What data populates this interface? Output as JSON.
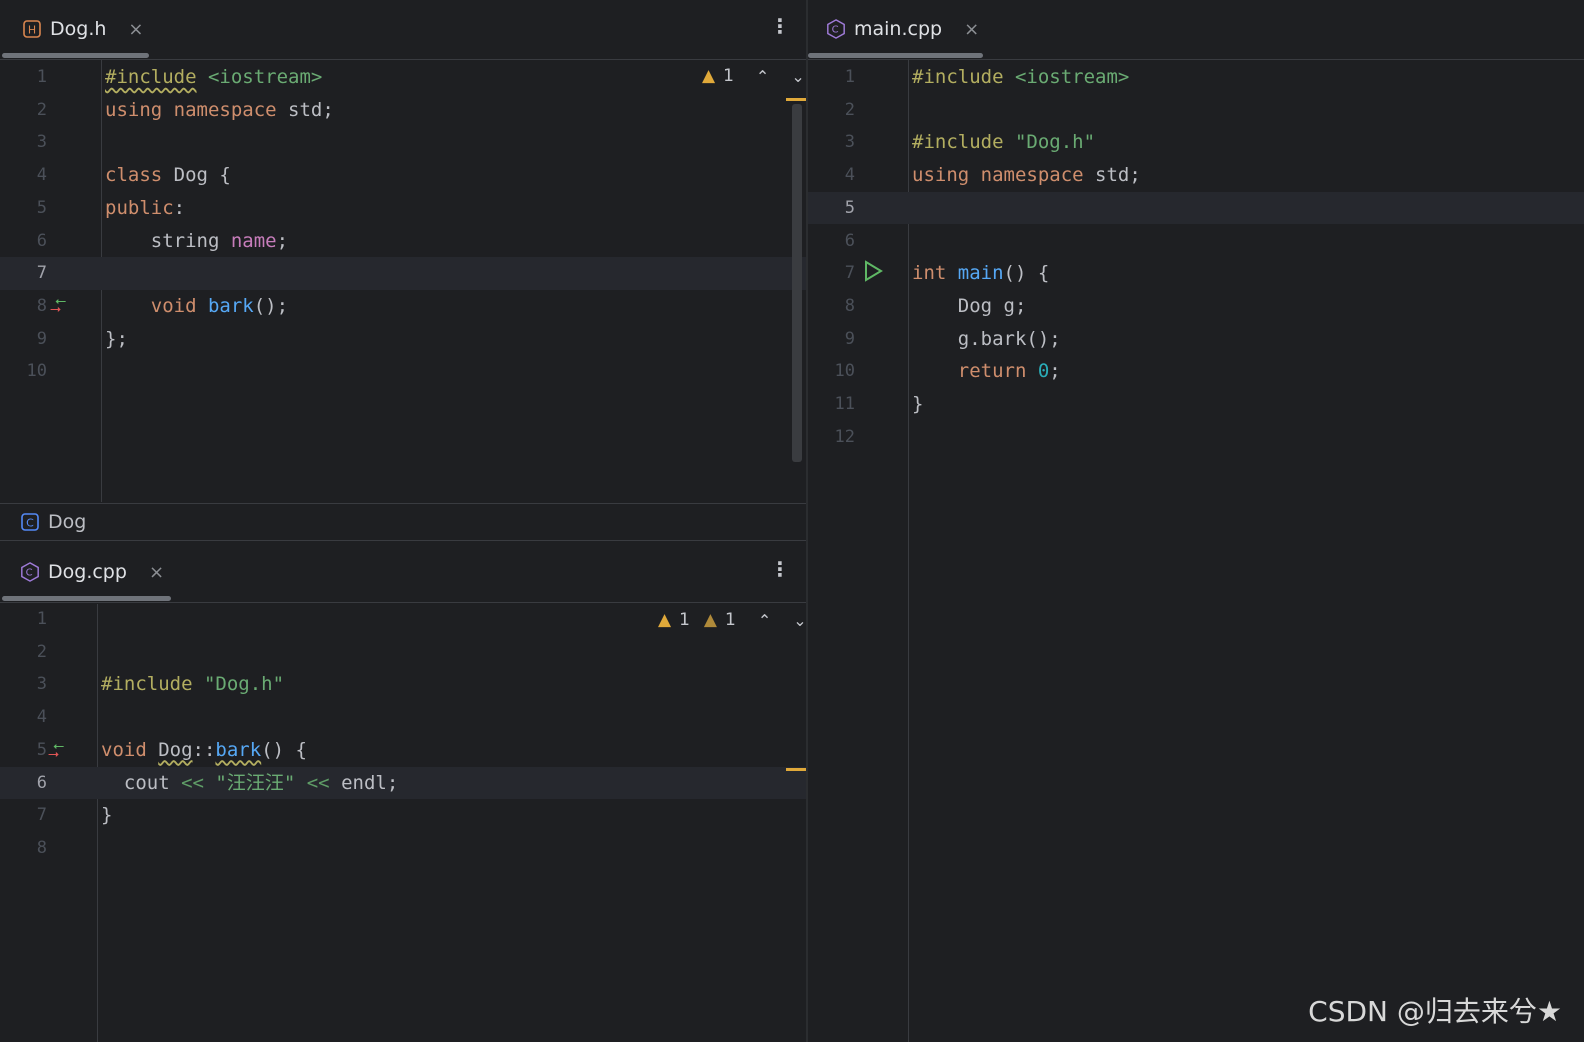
{
  "colors": {
    "background": "#1e1f22",
    "keyword": "#cf8e6d",
    "preprocessor": "#b3ae60",
    "string": "#6aab73",
    "function": "#56a8f5",
    "field": "#c77dbb",
    "number": "#2aacb8",
    "warning": "#e0a93a"
  },
  "dog_h": {
    "tab_label": "Dog.h",
    "file_icon_letter": "H",
    "close_glyph": "×",
    "menu_glyph": "⋮",
    "inspections": {
      "warnings": "1"
    },
    "breadcrumb": {
      "icon_letter": "C",
      "label": "Dog"
    },
    "lines": [
      {
        "n": "1",
        "parts": [
          [
            "pp wavy",
            "#include"
          ],
          [
            "",
            ""
          ],
          [
            "inc",
            " <iostream>"
          ]
        ]
      },
      {
        "n": "2",
        "parts": [
          [
            "kw",
            "using namespace "
          ],
          [
            "typ",
            "std;"
          ]
        ]
      },
      {
        "n": "3",
        "parts": []
      },
      {
        "n": "4",
        "parts": [
          [
            "kw",
            "class "
          ],
          [
            "typ",
            "Dog {"
          ]
        ]
      },
      {
        "n": "5",
        "parts": [
          [
            "kw",
            "public"
          ],
          [
            "typ",
            ":"
          ]
        ]
      },
      {
        "n": "6",
        "parts": [
          [
            "typ",
            "    string "
          ],
          [
            "fld",
            "name"
          ],
          [
            "typ",
            ";"
          ]
        ]
      },
      {
        "n": "7",
        "parts": []
      },
      {
        "n": "8",
        "parts": [
          [
            "kw",
            "    void "
          ],
          [
            "fn",
            "bark"
          ],
          [
            "typ",
            "();"
          ]
        ]
      },
      {
        "n": "9",
        "parts": [
          [
            "typ",
            "};"
          ]
        ]
      },
      {
        "n": "10",
        "parts": []
      }
    ]
  },
  "dog_cpp": {
    "tab_label": "Dog.cpp",
    "file_icon_letter": "C",
    "close_glyph": "×",
    "menu_glyph": "⋮",
    "inspections": {
      "warnings": "1",
      "weak_warnings": "1"
    },
    "lines": [
      {
        "n": "1",
        "parts": []
      },
      {
        "n": "2",
        "parts": []
      },
      {
        "n": "3",
        "parts": [
          [
            "pp",
            "#include "
          ],
          [
            "inc",
            "\"Dog.h\""
          ]
        ]
      },
      {
        "n": "4",
        "parts": []
      },
      {
        "n": "5",
        "parts": [
          [
            "kw",
            "void "
          ],
          [
            "typ wavy",
            "Dog"
          ],
          [
            "typ",
            "::"
          ],
          [
            "fn wavy",
            "bark"
          ],
          [
            "typ",
            "() {"
          ]
        ]
      },
      {
        "n": "6",
        "parts": [
          [
            "typ",
            "  cout "
          ],
          [
            "op",
            "<<"
          ],
          [
            "inc",
            " \"汪汪汪\" "
          ],
          [
            "op",
            "<<"
          ],
          [
            "typ",
            " endl;"
          ]
        ]
      },
      {
        "n": "7",
        "parts": [
          [
            "typ",
            "}"
          ]
        ]
      },
      {
        "n": "8",
        "parts": []
      }
    ]
  },
  "main_cpp": {
    "tab_label": "main.cpp",
    "file_icon_letter": "C",
    "close_glyph": "×",
    "lines": [
      {
        "n": "1",
        "parts": [
          [
            "pp",
            "#include "
          ],
          [
            "inc",
            "<iostream>"
          ]
        ]
      },
      {
        "n": "2",
        "parts": []
      },
      {
        "n": "3",
        "parts": [
          [
            "pp",
            "#include "
          ],
          [
            "inc",
            "\"Dog.h\""
          ]
        ]
      },
      {
        "n": "4",
        "parts": [
          [
            "kw",
            "using namespace "
          ],
          [
            "typ",
            "std;"
          ]
        ]
      },
      {
        "n": "5",
        "parts": []
      },
      {
        "n": "6",
        "parts": []
      },
      {
        "n": "7",
        "parts": [
          [
            "kw",
            "int "
          ],
          [
            "fn",
            "main"
          ],
          [
            "typ",
            "() {"
          ]
        ]
      },
      {
        "n": "8",
        "parts": [
          [
            "typ",
            "    Dog g;"
          ]
        ]
      },
      {
        "n": "9",
        "parts": [
          [
            "typ",
            "    g.bark();"
          ]
        ]
      },
      {
        "n": "10",
        "parts": [
          [
            "kw",
            "    return "
          ],
          [
            "num",
            "0"
          ],
          [
            "typ",
            ";"
          ]
        ]
      },
      {
        "n": "11",
        "parts": [
          [
            "typ",
            "}"
          ]
        ]
      },
      {
        "n": "12",
        "parts": []
      }
    ]
  },
  "watermark": "CSDN @归去来兮★"
}
